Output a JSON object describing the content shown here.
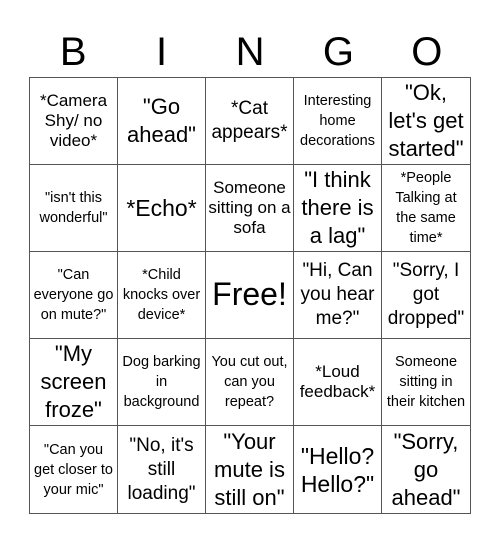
{
  "header": [
    "B",
    "I",
    "N",
    "G",
    "O"
  ],
  "cells": [
    {
      "text": "*Camera Shy/ no video*",
      "size": "s16"
    },
    {
      "text": "\"Go ahead\"",
      "size": "s22"
    },
    {
      "text": "*Cat appears*",
      "size": "s18"
    },
    {
      "text": "Interesting home decorations",
      "size": "s14"
    },
    {
      "text": "\"Ok, let's get started\"",
      "size": "s22"
    },
    {
      "text": "\"isn't this wonderful\"",
      "size": "s14"
    },
    {
      "text": "*Echo*",
      "size": "s24"
    },
    {
      "text": "Someone sitting on a sofa",
      "size": "s16"
    },
    {
      "text": "\"I think there is a lag\"",
      "size": "s22"
    },
    {
      "text": "*People Talking at the same time*",
      "size": "s14"
    },
    {
      "text": "\"Can everyone go on mute?\"",
      "size": "s14"
    },
    {
      "text": "*Child knocks over device*",
      "size": "s14"
    },
    {
      "text": "Free!",
      "size": "free"
    },
    {
      "text": "\"Hi, Can you hear me?\"",
      "size": "s18"
    },
    {
      "text": "\"Sorry, I got dropped\"",
      "size": "s18"
    },
    {
      "text": "\"My screen froze\"",
      "size": "s22"
    },
    {
      "text": "Dog barking in background",
      "size": "s14"
    },
    {
      "text": "You cut out, can you repeat?",
      "size": "s14"
    },
    {
      "text": "*Loud feedback*",
      "size": "s16"
    },
    {
      "text": "Someone sitting in their kitchen",
      "size": "s14"
    },
    {
      "text": "\"Can you get closer to your mic\"",
      "size": "s14"
    },
    {
      "text": "\"No, it's still loading\"",
      "size": "s18"
    },
    {
      "text": "\"Your mute is still on\"",
      "size": "s22"
    },
    {
      "text": "\"Hello? Hello?\"",
      "size": "s24"
    },
    {
      "text": "\"Sorry, go ahead\"",
      "size": "s22"
    }
  ]
}
